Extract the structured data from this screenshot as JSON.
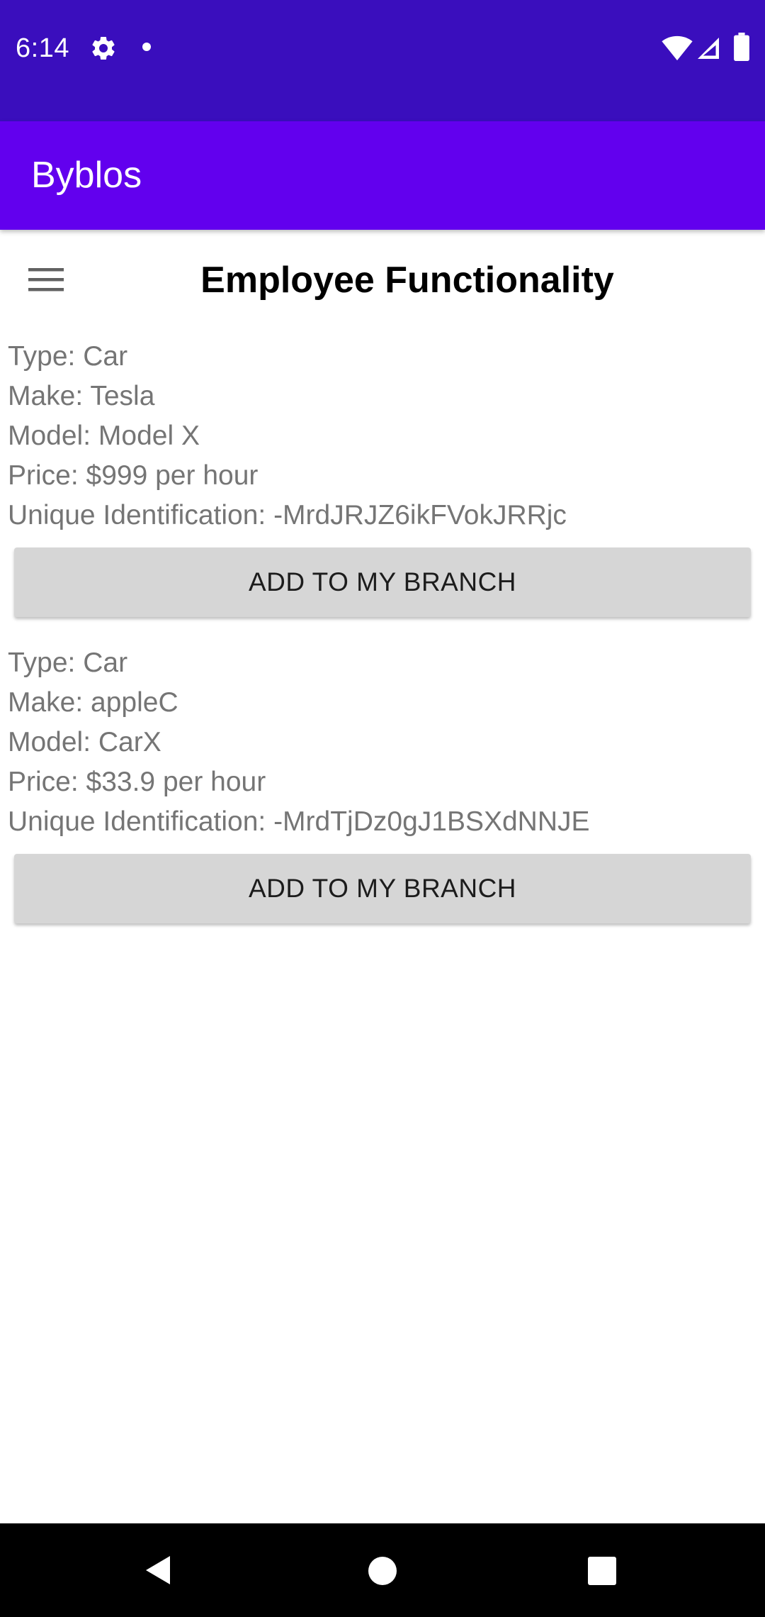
{
  "status_bar": {
    "time": "6:14",
    "icons": [
      "gear-icon",
      "notification-dot-icon",
      "wifi-icon",
      "signal-icon",
      "battery-icon"
    ]
  },
  "app_bar": {
    "title": "Byblos",
    "color": "#6200ee"
  },
  "header": {
    "menu_icon": "hamburger-menu-icon",
    "title": "Employee Functionality"
  },
  "items": [
    {
      "type": "Type: Car",
      "make": "Make: Tesla",
      "model": "Model: Model X",
      "price": "Price: $999 per hour",
      "uid": "Unique Identification: -MrdJRJZ6ikFVokJRRjc",
      "button_label": "ADD TO MY BRANCH"
    },
    {
      "type": "Type: Car",
      "make": "Make: appleC",
      "model": "Model: CarX",
      "price": "Price: $33.9 per hour",
      "uid": "Unique Identification: -MrdTjDz0gJ1BSXdNNJE",
      "button_label": "ADD TO MY BRANCH"
    }
  ],
  "nav_bar": {
    "icons": [
      "back-icon",
      "home-icon",
      "recents-icon"
    ]
  },
  "colors": {
    "status_bar": "#3a0ebd",
    "app_bar": "#6200ee",
    "button_bg": "#d6d6d6",
    "item_text": "#757575"
  }
}
